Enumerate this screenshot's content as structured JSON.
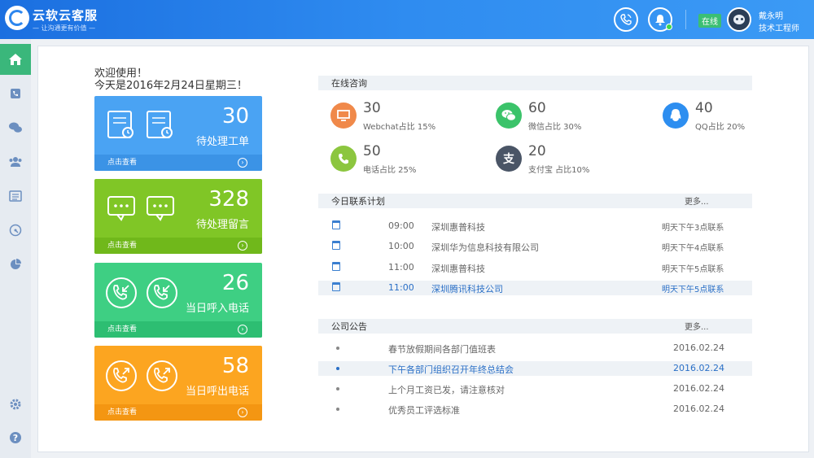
{
  "header": {
    "brand_name": "云软云客服",
    "brand_slogan": "— 让沟通更有价值 —",
    "online_status": "在线",
    "user_name": "戴永明",
    "user_role": "技术工程师"
  },
  "welcome": {
    "line1": "欢迎使用！",
    "line2": "今天是2016年2月24日星期三！"
  },
  "cards": [
    {
      "value": "30",
      "label": "待处理工单",
      "link": "点击查看"
    },
    {
      "value": "328",
      "label": "待处理留言",
      "link": "点击查看"
    },
    {
      "value": "26",
      "label": "当日呼入电话",
      "link": "点击查看"
    },
    {
      "value": "58",
      "label": "当日呼出电话",
      "link": "点击查看"
    }
  ],
  "consult": {
    "title": "在线咨询",
    "items": [
      {
        "value": "30",
        "label": "Webchat占比 15%",
        "icon": "monitor-icon",
        "color": "#f0894a"
      },
      {
        "value": "60",
        "label": "微信占比 30%",
        "icon": "wechat-icon",
        "color": "#3bc36a"
      },
      {
        "value": "40",
        "label": "QQ占比 20%",
        "icon": "qq-icon",
        "color": "#2d8ef0"
      },
      {
        "value": "50",
        "label": "电话占比 25%",
        "icon": "phone-icon",
        "color": "#8cc63f"
      },
      {
        "value": "20",
        "label": "支付宝 占比10%",
        "icon": "alipay-icon",
        "color": "#4a5566"
      }
    ]
  },
  "plan": {
    "title": "今日联系计划",
    "more": "更多...",
    "rows": [
      {
        "time": "09:00",
        "company": "深圳惠普科技",
        "note": "明天下午3点联系"
      },
      {
        "time": "10:00",
        "company": "深圳华为信息科技有限公司",
        "note": "明天下午4点联系"
      },
      {
        "time": "11:00",
        "company": "深圳惠普科技",
        "note": "明天下午5点联系"
      },
      {
        "time": "11:00",
        "company": "深圳腾讯科技公司",
        "note": "明天下午5点联系"
      }
    ]
  },
  "notices": {
    "title": "公司公告",
    "more": "更多...",
    "rows": [
      {
        "title": "春节放假期间各部门值班表",
        "date": "2016.02.24"
      },
      {
        "title": "下午各部门组织召开年终总结会",
        "date": "2016.02.24"
      },
      {
        "title": "上个月工资已发，请注意核对",
        "date": "2016.02.24"
      },
      {
        "title": "优秀员工评选标准",
        "date": "2016.02.24"
      }
    ]
  },
  "colors": {
    "header": "#2f8cf0",
    "active_sidebar": "#3ab77b",
    "card_blue": "#4aa3f3",
    "card_green": "#80c626",
    "card_teal": "#3ecf83",
    "card_orange": "#fca520",
    "highlight_text": "#2a6fc6"
  }
}
